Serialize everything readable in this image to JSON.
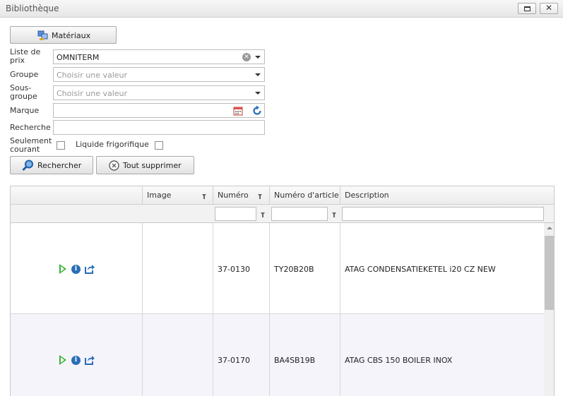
{
  "window": {
    "title": "Bibliothèque"
  },
  "toolbar": {
    "materials_label": "Matériaux"
  },
  "form": {
    "price_list": {
      "label_line1": "Liste de",
      "label_line2": "prix",
      "value": "OMNITERM"
    },
    "group": {
      "label": "Groupe",
      "placeholder": "Choisir une valeur"
    },
    "subgroup": {
      "label_line1": "Sous-",
      "label_line2": "groupe",
      "placeholder": "Choisir une valeur"
    },
    "brand": {
      "label": "Marque",
      "value": ""
    },
    "search": {
      "label": "Recherche",
      "value": ""
    },
    "current_only": {
      "label_line1": "Seulement",
      "label_line2": "courant",
      "checked": false
    },
    "refrigerant": {
      "label": "Liquide frigorifique",
      "checked": false
    }
  },
  "actions": {
    "search_label": "Rechercher",
    "clear_label": "Tout supprimer"
  },
  "grid": {
    "columns": [
      "Image",
      "Numéro",
      "Numéro d'article",
      "Description"
    ],
    "rows": [
      {
        "number": "37-0130",
        "article": "TY20B20B",
        "description": "ATAG CONDENSATIEKETEL i20 CZ NEW"
      },
      {
        "number": "37-0170",
        "article": "BA4SB19B",
        "description": "ATAG CBS 150 BOILER INOX"
      }
    ]
  },
  "icons": {
    "materials": "materials-icon",
    "calendar": "calendar-icon",
    "refresh": "refresh-icon",
    "search": "magnifier-icon",
    "clear": "clear-circle-icon",
    "play": "play-icon",
    "info": "info-icon",
    "share": "share-icon"
  },
  "colors": {
    "play": "#36b536",
    "info": "#2a6eb8",
    "row_alt": "#f6f4fb"
  }
}
